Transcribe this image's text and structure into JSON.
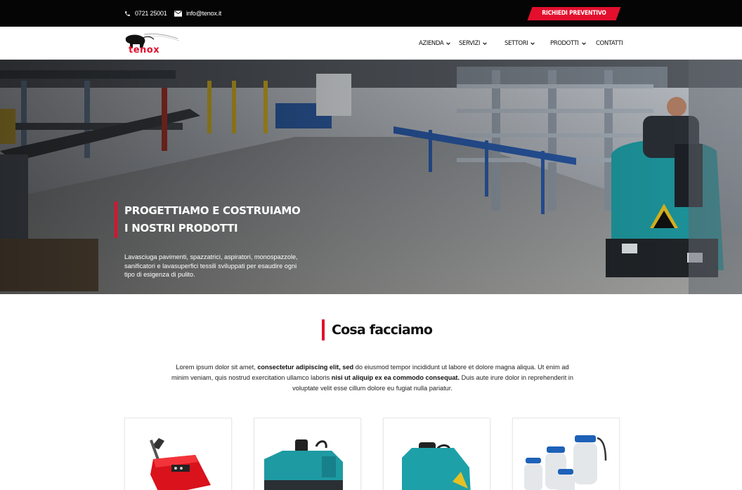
{
  "topbar": {
    "phone": "0721 25001",
    "email": "info@tenox.it",
    "cta_label": "RICHIEDI PREVENTIVO"
  },
  "brand": {
    "logo_text": "tenox",
    "accent_color": "#e30f2d",
    "dark_color": "#050505"
  },
  "nav": {
    "items": [
      {
        "label": "AZIENDA",
        "has_dropdown": true
      },
      {
        "label": "SERVIZI",
        "has_dropdown": true
      },
      {
        "label": "SETTORI",
        "has_dropdown": true
      },
      {
        "label": "PRODOTTI",
        "has_dropdown": true
      },
      {
        "label": "CONTATTI",
        "has_dropdown": false
      }
    ]
  },
  "hero": {
    "title_line1": "PROGETTIAMO E COSTRUIAMO",
    "title_line2": "I NOSTRI PRODOTTI",
    "description": "Lavasciuga pavimenti, spazzatrici, aspiratori, monospazzole, sanificatori e lavasuperfici tessili sviluppati per esaudire ogni tipo di esigenza di pulito."
  },
  "section": {
    "title": "Cosa facciamo",
    "intro_part1": "Lorem ipsum dolor sit amet, ",
    "intro_bold1": "consectetur adipiscing elit, sed",
    "intro_part2": " do eiusmod tempor incididunt ut labore et dolore magna aliqua. Ut enim ad minim veniam, quis nostrud exercitation ullamco laboris ",
    "intro_bold2": "nisi ut aliquip ex ea commodo consequat.",
    "intro_part3": " Duis aute irure dolor in reprehenderit in voluptate velit esse cillum dolore eu fugiat nulla pariatur."
  },
  "icons": {
    "phone": "phone-icon",
    "email": "envelope-icon",
    "dropdown": "chevron-down-icon"
  }
}
